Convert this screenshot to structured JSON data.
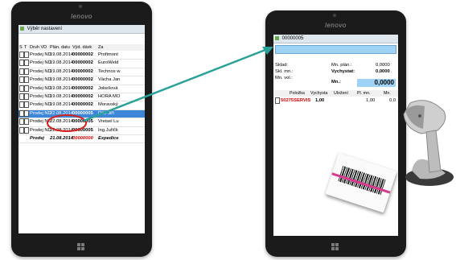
{
  "tablet_left": {
    "brand": "lenovo",
    "window_title": "Výběr nastavení",
    "columns": [
      "S",
      "T",
      "Druh VD",
      "Plán. datu",
      "Výd. dávk",
      "Za"
    ],
    "rows": [
      {
        "type": "Prodej ND",
        "date": "19.08.2014",
        "number": "00000002",
        "partner": "Profimont"
      },
      {
        "type": "Prodej ND",
        "date": "19.08.2014",
        "number": "00000002",
        "partner": "EuroWeld"
      },
      {
        "type": "Prodej ND",
        "date": "19.08.2014",
        "number": "00000002",
        "partner": "Technos w"
      },
      {
        "type": "Prodej ND",
        "date": "19.08.2014",
        "number": "00000002",
        "partner": "Vácha Jan"
      },
      {
        "type": "Prodej ND",
        "date": "19.08.2014",
        "number": "00000002",
        "partner": "Jokešová"
      },
      {
        "type": "Prodej ND",
        "date": "19.08.2014",
        "number": "00000002",
        "partner": "HORA MO"
      },
      {
        "type": "Prodej ND",
        "date": "19.08.2014",
        "number": "00000002",
        "partner": "Moravský"
      },
      {
        "type": "Prodej ND",
        "date": "22.08.2014",
        "number": "00000005",
        "partner": "Dítě Jiří",
        "selected": true
      },
      {
        "type": "Prodej ND",
        "date": "22.08.2014",
        "number": "00000005",
        "partner": "Vreisel Lu"
      },
      {
        "type": "Prodej ND",
        "date": "22.08.2014",
        "number": "00000005",
        "partner": "Ing.Juřičk"
      },
      {
        "type": "Prodej",
        "date": "21.08.2014",
        "number": "00000000",
        "partner": "Expedice",
        "summary": true
      }
    ]
  },
  "tablet_right": {
    "brand": "lenovo",
    "window_title": "00000005",
    "fields": {
      "sklad_label": "Sklad:",
      "skl_mn_label": "Skl. mn.:",
      "mn_vol_label": "Mn. vol.:",
      "mn_plan_label": "Mn. plán.:",
      "mn_plan_value": "0,0000",
      "vychystat_label": "Vychystat:",
      "vychystat_value": "0,0000",
      "mn_label": "Mn.:",
      "mn_value": "0,0000"
    },
    "grid_columns": [
      "Položka",
      "Vychysta",
      "Uložení",
      "Pl. mn.",
      "Mn."
    ],
    "grid_row": {
      "item": "50275SERVIS",
      "vychystat": "1,00",
      "pl_mn": "1,00",
      "mn": "0,0"
    }
  },
  "colors": {
    "highlight": "#3d86d8",
    "input_bg": "#9fd3f5",
    "arrow": "#2aa198",
    "circle": "#d62020",
    "accent_red": "#d40000"
  }
}
